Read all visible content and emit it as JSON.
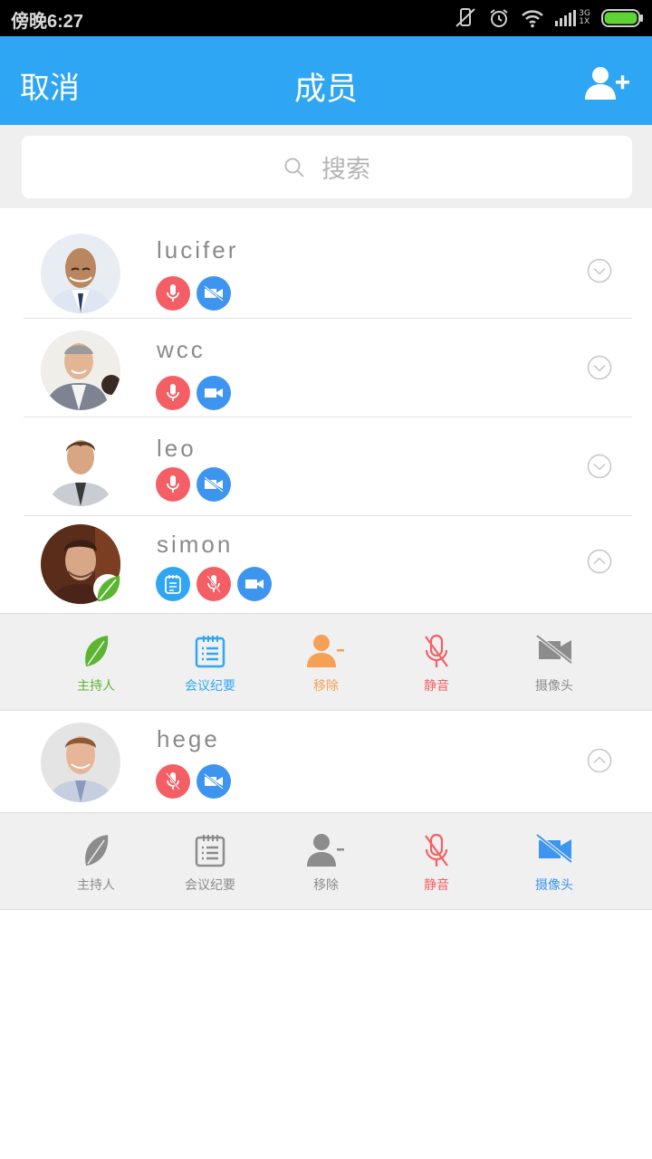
{
  "status_bar": {
    "time": "傍晚6:27",
    "network": "3G",
    "network_sub": "1X"
  },
  "header": {
    "cancel_label": "取消",
    "title": "成员"
  },
  "search": {
    "placeholder": "搜索"
  },
  "members": [
    {
      "name": "lucifer",
      "mic": "on",
      "camera": "off",
      "expanded": false
    },
    {
      "name": "wcc",
      "mic": "on",
      "camera": "on",
      "expanded": false
    },
    {
      "name": "leo",
      "mic": "on",
      "camera": "off",
      "expanded": false
    },
    {
      "name": "simon",
      "host": true,
      "minutes": true,
      "mic": "muted",
      "camera": "on",
      "expanded": true
    },
    {
      "name": "hege",
      "mic": "muted",
      "camera": "off",
      "expanded": true
    }
  ],
  "action_panels": [
    {
      "host": "主持人",
      "minutes": "会议纪要",
      "remove": "移除",
      "mute": "静音",
      "camera": "摄像头"
    },
    {
      "host": "主持人",
      "minutes": "会议纪要",
      "remove": "移除",
      "mute": "静音",
      "camera": "摄像头"
    }
  ],
  "colors": {
    "header": "#2fa6f3",
    "red": "#f35f64",
    "blue": "#3e95ef",
    "green": "#5cb531",
    "orange": "#f5a055",
    "gray": "#8c8c8c"
  }
}
